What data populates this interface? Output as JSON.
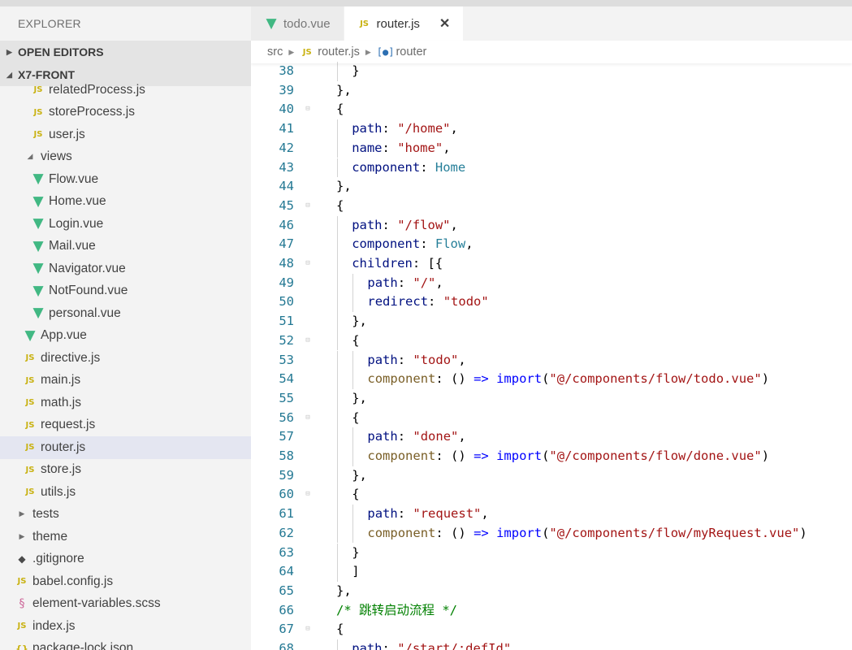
{
  "sidebar": {
    "title": "EXPLORER",
    "sections": [
      {
        "label": "OPEN EDITORS",
        "chev": "▶"
      },
      {
        "label": "X7-FRONT",
        "chev": "◢"
      }
    ],
    "items": [
      {
        "label": "relatedProcess.js",
        "icon": "js",
        "glyph": "JS",
        "indent": 38,
        "name": "file-relatedProcess-js"
      },
      {
        "label": "storeProcess.js",
        "icon": "js",
        "glyph": "JS",
        "indent": 38,
        "name": "file-storeProcess-js"
      },
      {
        "label": "user.js",
        "icon": "js",
        "glyph": "JS",
        "indent": 38,
        "name": "file-user-js"
      },
      {
        "label": "views",
        "icon": "chev",
        "glyph": "◢",
        "indent": 28,
        "name": "folder-views"
      },
      {
        "label": "Flow.vue",
        "icon": "vue",
        "glyph": "▼",
        "indent": 38,
        "name": "file-Flow-vue"
      },
      {
        "label": "Home.vue",
        "icon": "vue",
        "glyph": "▼",
        "indent": 38,
        "name": "file-Home-vue"
      },
      {
        "label": "Login.vue",
        "icon": "vue",
        "glyph": "▼",
        "indent": 38,
        "name": "file-Login-vue"
      },
      {
        "label": "Mail.vue",
        "icon": "vue",
        "glyph": "▼",
        "indent": 38,
        "name": "file-Mail-vue"
      },
      {
        "label": "Navigator.vue",
        "icon": "vue",
        "glyph": "▼",
        "indent": 38,
        "name": "file-Navigator-vue"
      },
      {
        "label": "NotFound.vue",
        "icon": "vue",
        "glyph": "▼",
        "indent": 38,
        "name": "file-NotFound-vue"
      },
      {
        "label": "personal.vue",
        "icon": "vue",
        "glyph": "▼",
        "indent": 38,
        "name": "file-personal-vue"
      },
      {
        "label": "App.vue",
        "icon": "vue",
        "glyph": "▼",
        "indent": 28,
        "name": "file-App-vue"
      },
      {
        "label": "directive.js",
        "icon": "js",
        "glyph": "JS",
        "indent": 28,
        "name": "file-directive-js"
      },
      {
        "label": "main.js",
        "icon": "js",
        "glyph": "JS",
        "indent": 28,
        "name": "file-main-js"
      },
      {
        "label": "math.js",
        "icon": "js",
        "glyph": "JS",
        "indent": 28,
        "name": "file-math-js"
      },
      {
        "label": "request.js",
        "icon": "js",
        "glyph": "JS",
        "indent": 28,
        "name": "file-request-js"
      },
      {
        "label": "router.js",
        "icon": "js",
        "glyph": "JS",
        "indent": 28,
        "name": "file-router-js",
        "selected": true
      },
      {
        "label": "store.js",
        "icon": "js",
        "glyph": "JS",
        "indent": 28,
        "name": "file-store-js"
      },
      {
        "label": "utils.js",
        "icon": "js",
        "glyph": "JS",
        "indent": 28,
        "name": "file-utils-js"
      },
      {
        "label": "tests",
        "icon": "chev",
        "glyph": "▶",
        "indent": 18,
        "name": "folder-tests"
      },
      {
        "label": "theme",
        "icon": "chev",
        "glyph": "▶",
        "indent": 18,
        "name": "folder-theme"
      },
      {
        "label": ".gitignore",
        "icon": "git",
        "glyph": "◆",
        "indent": 18,
        "name": "file-gitignore"
      },
      {
        "label": "babel.config.js",
        "icon": "js",
        "glyph": "JS",
        "indent": 18,
        "name": "file-babel-config-js"
      },
      {
        "label": "element-variables.scss",
        "icon": "scss",
        "glyph": "§",
        "indent": 18,
        "name": "file-element-variables-scss"
      },
      {
        "label": "index.js",
        "icon": "js",
        "glyph": "JS",
        "indent": 18,
        "name": "file-index-js"
      },
      {
        "label": "package-lock.json",
        "icon": "json",
        "glyph": "{}",
        "indent": 18,
        "name": "file-package-lock-json"
      }
    ]
  },
  "tabs": [
    {
      "label": "todo.vue",
      "icon": "vue",
      "glyph": "▼",
      "active": false
    },
    {
      "label": "router.js",
      "icon": "js",
      "glyph": "JS",
      "active": true,
      "close": "✕"
    }
  ],
  "breadcrumb": {
    "segments": [
      "src",
      "router.js",
      "router"
    ],
    "file_icon": "JS",
    "symbol_icon": "[●]"
  },
  "code": [
    {
      "n": "38",
      "d": 2,
      "f": false,
      "t": [
        [
          "p",
          "}"
        ]
      ]
    },
    {
      "n": "39",
      "d": 1,
      "f": false,
      "t": [
        [
          "p",
          "},"
        ]
      ]
    },
    {
      "n": "40",
      "d": 1,
      "f": true,
      "t": [
        [
          "p",
          "{"
        ]
      ]
    },
    {
      "n": "41",
      "d": 2,
      "f": false,
      "t": [
        [
          "k",
          "path"
        ],
        [
          "p",
          ": "
        ],
        [
          "s",
          "\"/home\""
        ],
        [
          "p",
          ","
        ]
      ]
    },
    {
      "n": "42",
      "d": 2,
      "f": false,
      "t": [
        [
          "k",
          "name"
        ],
        [
          "p",
          ": "
        ],
        [
          "s",
          "\"home\""
        ],
        [
          "p",
          ","
        ]
      ]
    },
    {
      "n": "43",
      "d": 2,
      "f": false,
      "t": [
        [
          "k",
          "component"
        ],
        [
          "p",
          ": "
        ],
        [
          "id",
          "Home"
        ]
      ]
    },
    {
      "n": "44",
      "d": 1,
      "f": false,
      "t": [
        [
          "p",
          "},"
        ]
      ]
    },
    {
      "n": "45",
      "d": 1,
      "f": true,
      "t": [
        [
          "p",
          "{"
        ]
      ]
    },
    {
      "n": "46",
      "d": 2,
      "f": false,
      "t": [
        [
          "k",
          "path"
        ],
        [
          "p",
          ": "
        ],
        [
          "s",
          "\"/flow\""
        ],
        [
          "p",
          ","
        ]
      ]
    },
    {
      "n": "47",
      "d": 2,
      "f": false,
      "t": [
        [
          "k",
          "component"
        ],
        [
          "p",
          ": "
        ],
        [
          "id",
          "Flow"
        ],
        [
          "p",
          ","
        ]
      ]
    },
    {
      "n": "48",
      "d": 2,
      "f": true,
      "t": [
        [
          "k",
          "children"
        ],
        [
          "p",
          ": [{"
        ]
      ]
    },
    {
      "n": "49",
      "d": 3,
      "f": false,
      "t": [
        [
          "k",
          "path"
        ],
        [
          "p",
          ": "
        ],
        [
          "s",
          "\"/\""
        ],
        [
          "p",
          ","
        ]
      ]
    },
    {
      "n": "50",
      "d": 3,
      "f": false,
      "t": [
        [
          "k",
          "redirect"
        ],
        [
          "p",
          ": "
        ],
        [
          "s",
          "\"todo\""
        ]
      ]
    },
    {
      "n": "51",
      "d": 2,
      "f": false,
      "t": [
        [
          "p",
          "},"
        ]
      ]
    },
    {
      "n": "52",
      "d": 2,
      "f": true,
      "t": [
        [
          "p",
          "{"
        ]
      ]
    },
    {
      "n": "53",
      "d": 3,
      "f": false,
      "t": [
        [
          "k",
          "path"
        ],
        [
          "p",
          ": "
        ],
        [
          "s",
          "\"todo\""
        ],
        [
          "p",
          ","
        ]
      ]
    },
    {
      "n": "54",
      "d": 3,
      "f": false,
      "t": [
        [
          "fn",
          "component"
        ],
        [
          "p",
          ": () "
        ],
        [
          "kw",
          "=>"
        ],
        [
          "p",
          " "
        ],
        [
          "kw",
          "import"
        ],
        [
          "p",
          "("
        ],
        [
          "s",
          "\"@/components/flow/todo.vue\""
        ],
        [
          "p",
          ")"
        ]
      ]
    },
    {
      "n": "55",
      "d": 2,
      "f": false,
      "t": [
        [
          "p",
          "},"
        ]
      ]
    },
    {
      "n": "56",
      "d": 2,
      "f": true,
      "t": [
        [
          "p",
          "{"
        ]
      ]
    },
    {
      "n": "57",
      "d": 3,
      "f": false,
      "t": [
        [
          "k",
          "path"
        ],
        [
          "p",
          ": "
        ],
        [
          "s",
          "\"done\""
        ],
        [
          "p",
          ","
        ]
      ]
    },
    {
      "n": "58",
      "d": 3,
      "f": false,
      "t": [
        [
          "fn",
          "component"
        ],
        [
          "p",
          ": () "
        ],
        [
          "kw",
          "=>"
        ],
        [
          "p",
          " "
        ],
        [
          "kw",
          "import"
        ],
        [
          "p",
          "("
        ],
        [
          "s",
          "\"@/components/flow/done.vue\""
        ],
        [
          "p",
          ")"
        ]
      ]
    },
    {
      "n": "59",
      "d": 2,
      "f": false,
      "t": [
        [
          "p",
          "},"
        ]
      ]
    },
    {
      "n": "60",
      "d": 2,
      "f": true,
      "t": [
        [
          "p",
          "{"
        ]
      ]
    },
    {
      "n": "61",
      "d": 3,
      "f": false,
      "t": [
        [
          "k",
          "path"
        ],
        [
          "p",
          ": "
        ],
        [
          "s",
          "\"request\""
        ],
        [
          "p",
          ","
        ]
      ]
    },
    {
      "n": "62",
      "d": 3,
      "f": false,
      "t": [
        [
          "fn",
          "component"
        ],
        [
          "p",
          ": () "
        ],
        [
          "kw",
          "=>"
        ],
        [
          "p",
          " "
        ],
        [
          "kw",
          "import"
        ],
        [
          "p",
          "("
        ],
        [
          "s",
          "\"@/components/flow/myRequest.vue\""
        ],
        [
          "p",
          ")"
        ]
      ]
    },
    {
      "n": "63",
      "d": 2,
      "f": false,
      "t": [
        [
          "p",
          "}"
        ]
      ]
    },
    {
      "n": "64",
      "d": 2,
      "f": false,
      "t": [
        [
          "p",
          "]"
        ]
      ]
    },
    {
      "n": "65",
      "d": 1,
      "f": false,
      "t": [
        [
          "p",
          "},"
        ]
      ]
    },
    {
      "n": "66",
      "d": 1,
      "f": false,
      "t": [
        [
          "c",
          "/* 跳转启动流程 */"
        ]
      ]
    },
    {
      "n": "67",
      "d": 1,
      "f": true,
      "t": [
        [
          "p",
          "{"
        ]
      ]
    },
    {
      "n": "68",
      "d": 2,
      "f": false,
      "t": [
        [
          "k",
          "path"
        ],
        [
          "p",
          ": "
        ],
        [
          "s",
          "\"/start/:defId\""
        ],
        [
          "p",
          ","
        ]
      ]
    }
  ]
}
